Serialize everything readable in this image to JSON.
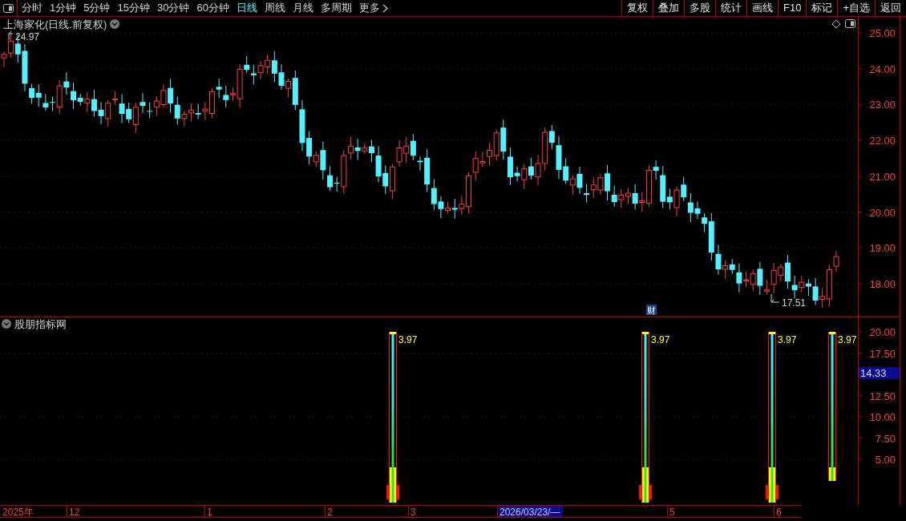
{
  "toolbar": {
    "periods": [
      {
        "label": "分时",
        "selected": false
      },
      {
        "label": "1分钟",
        "selected": false
      },
      {
        "label": "5分钟",
        "selected": false
      },
      {
        "label": "15分钟",
        "selected": false
      },
      {
        "label": "30分钟",
        "selected": false
      },
      {
        "label": "60分钟",
        "selected": false
      },
      {
        "label": "日线",
        "selected": true
      },
      {
        "label": "周线",
        "selected": false
      },
      {
        "label": "月线",
        "selected": false
      },
      {
        "label": "多周期",
        "selected": false
      },
      {
        "label": "更多",
        "selected": false
      }
    ],
    "actions": [
      "复权",
      "叠加",
      "多股",
      "统计",
      "画线",
      "F10",
      "标记",
      "+自选",
      "返回"
    ]
  },
  "price_chart": {
    "title": "上海家化(日线.前复权)",
    "high_label": "24.97",
    "low_label": "17.51",
    "event_badge": "财",
    "y_axis": [
      "25.00",
      "24.00",
      "23.00",
      "22.00",
      "21.00",
      "20.00",
      "19.00",
      "18.00"
    ]
  },
  "indicator": {
    "title": "股朋指标网",
    "y_axis": [
      "20.00",
      "17.50",
      "12.50",
      "10.00",
      "7.50",
      "5.00"
    ],
    "current_value": "14.33",
    "signals": [
      {
        "label": "3.97",
        "complete": true
      },
      {
        "label": "3.97",
        "complete": true
      },
      {
        "label": "3.97",
        "complete": true
      },
      {
        "label": "3.97",
        "complete": false
      }
    ]
  },
  "time_axis": [
    {
      "label": "2025年",
      "kind": "year"
    },
    {
      "label": "12",
      "kind": "month"
    },
    {
      "label": "1",
      "kind": "month"
    },
    {
      "label": "2",
      "kind": "month"
    },
    {
      "label": "3",
      "kind": "month"
    },
    {
      "label": "2026/03/23/—",
      "kind": "cursor"
    },
    {
      "label": "5",
      "kind": "month"
    },
    {
      "label": "6",
      "kind": "month"
    }
  ]
}
